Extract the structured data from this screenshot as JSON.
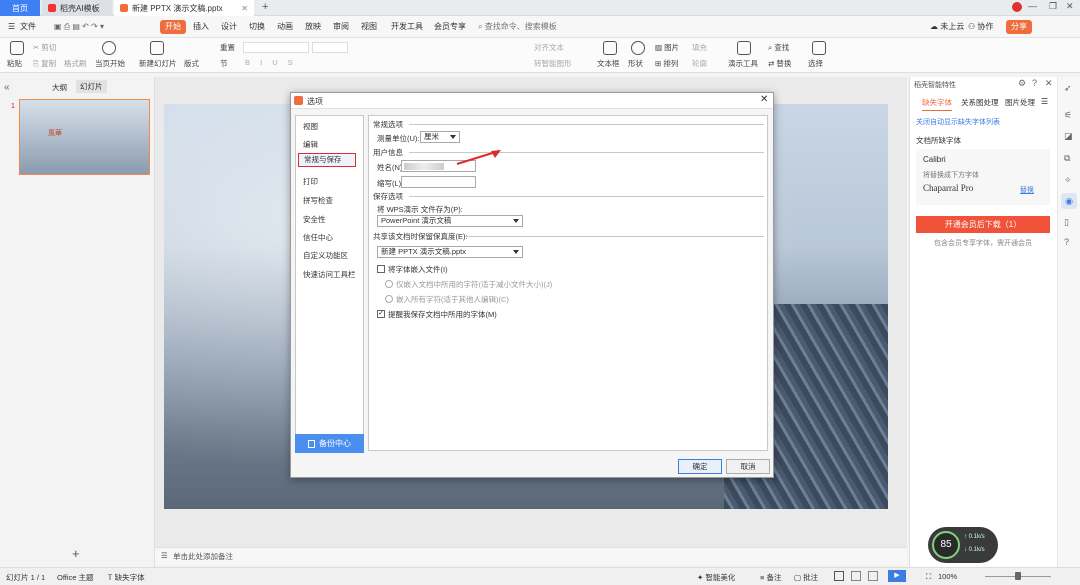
{
  "titlebar": {
    "home_tab": "首页",
    "tab2": "稻壳AI模板",
    "tab3": "新建 PPTX 演示文稿.pptx",
    "add_tab": "+"
  },
  "menubar": {
    "file": "文件",
    "items": [
      "开始",
      "插入",
      "设计",
      "切换",
      "动画",
      "放映",
      "审阅",
      "视图",
      "开发工具",
      "会员专享"
    ],
    "search_placeholder": "查找命令、搜索模板",
    "right": [
      "未上云",
      "协作",
      "分享"
    ]
  },
  "ribbon": {
    "paste": "粘贴",
    "cut": "剪切",
    "copy": "复制",
    "format_painter": "格式刷",
    "play_from_start": "当页开始",
    "new_slide": "新建幻灯片",
    "layout": "版式",
    "section": "节",
    "reset": "重置",
    "align_text": "对齐文本",
    "convert_smartart": "转智能图形",
    "textbox": "文本框",
    "shape": "形状",
    "picture": "图片",
    "fill": "填充",
    "arrange": "排列",
    "outline": "轮廓",
    "presentation_tools": "演示工具",
    "find": "查找",
    "replace": "替换",
    "select": "选择"
  },
  "leftpanel": {
    "tab_outline": "大纲",
    "tab_slides": "幻灯片",
    "slide_number": "1",
    "add": "+"
  },
  "notes": {
    "placeholder": "单击此处添加备注"
  },
  "rightpanel": {
    "title": "稻壳智能特性",
    "tabs": [
      "缺失字体",
      "关系图处理",
      "图片处理"
    ],
    "close_hint": "关闭自动显示缺失字体列表",
    "section_title": "文档所缺字体",
    "font1": "Calibri",
    "replace_note": "将替换成下方字体",
    "font2": "Chaparral Pro",
    "font2_action": "替换",
    "cta_button": "开通会员后下载（1）",
    "cta_sub": "包含会员专享字体，需开通会员"
  },
  "statusbar": {
    "slide_info": "幻灯片 1 / 1",
    "theme": "Office 主题",
    "missing_font": "缺失字体",
    "smart_beautify": "智能美化",
    "notes": "备注",
    "comments": "批注",
    "zoom": "100%"
  },
  "speedmeter": {
    "percent": "85",
    "up": "0.1",
    "down": "0.1",
    "unit": "k/s"
  },
  "dialog": {
    "title": "选项",
    "nav": [
      "视图",
      "编辑",
      "常规与保存",
      "打印",
      "拼写检查",
      "安全性",
      "信任中心",
      "自定义功能区",
      "快速访问工具栏"
    ],
    "selected_nav": "常规与保存",
    "backup_button": "备份中心",
    "general_section": "常规选项",
    "unit_label": "测量单位(U):",
    "unit_value": "厘米",
    "user_section": "用户信息",
    "name_label": "姓名(N):",
    "initials_label": "缩写(L):",
    "save_section": "保存选项",
    "save_as_label": "将 WPS演示 文件存为(P):",
    "save_as_value": "PowerPoint 演示文稿",
    "share_section": "共享该文档时保留保真度(E):",
    "share_value": "新建 PPTX 演示文稿.pptx",
    "embed_fonts": "将字体嵌入文件(I)",
    "embed_opt1": "仅嵌入文档中所用的字符(适于减小文件大小)(J)",
    "embed_opt2": "嵌入所有字符(适于其他人编辑)(C)",
    "remind_fonts": "提醒我保存文档中所用的字体(M)",
    "ok": "确定",
    "cancel": "取消"
  }
}
